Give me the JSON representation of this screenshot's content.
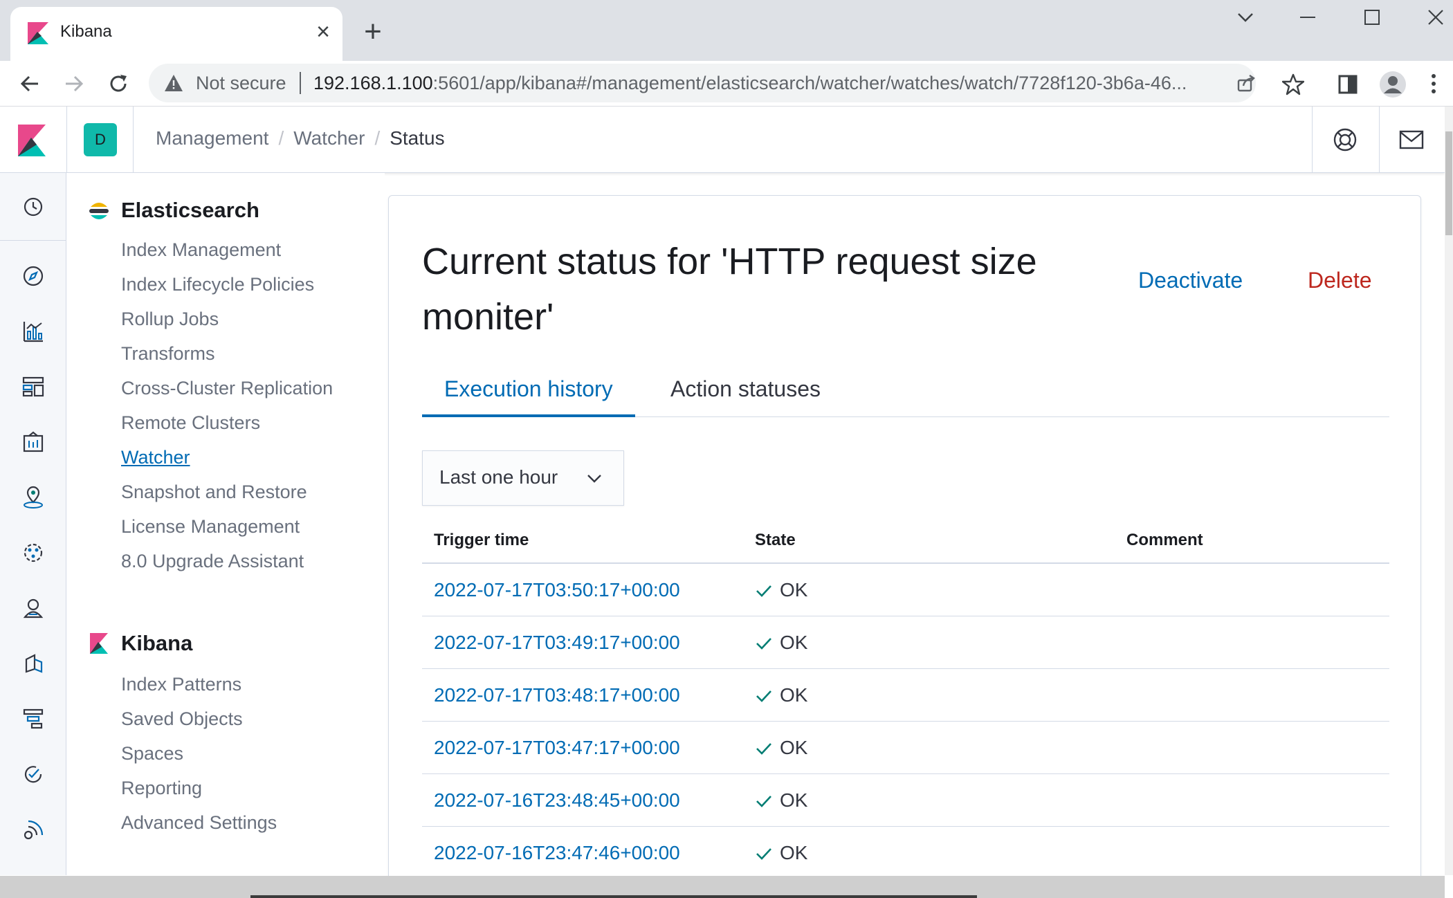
{
  "browser": {
    "tab_title": "Kibana",
    "url_warning": "Not secure",
    "url_host": "192.168.1.100",
    "url_rest": ":5601/app/kibana#/management/elasticsearch/watcher/watches/watch/7728f120-3b6a-46..."
  },
  "header": {
    "space_initial": "D",
    "breadcrumbs": [
      "Management",
      "Watcher",
      "Status"
    ],
    "separator": "/"
  },
  "sidenav": {
    "elasticsearch": {
      "title": "Elasticsearch",
      "items": [
        "Index Management",
        "Index Lifecycle Policies",
        "Rollup Jobs",
        "Transforms",
        "Cross-Cluster Replication",
        "Remote Clusters",
        "Watcher",
        "Snapshot and Restore",
        "License Management",
        "8.0 Upgrade Assistant"
      ],
      "active_item": "Watcher"
    },
    "kibana": {
      "title": "Kibana",
      "items": [
        "Index Patterns",
        "Saved Objects",
        "Spaces",
        "Reporting",
        "Advanced Settings"
      ]
    }
  },
  "main": {
    "title": "Current status for 'HTTP request size moniter'",
    "actions": {
      "deactivate": "Deactivate",
      "delete": "Delete"
    },
    "tabs": [
      {
        "label": "Execution history",
        "selected": true
      },
      {
        "label": "Action statuses",
        "selected": false
      }
    ],
    "time_range": "Last one hour",
    "table": {
      "columns": [
        "Trigger time",
        "State",
        "Comment"
      ],
      "rows": [
        {
          "trigger_time": "2022-07-17T03:50:17+00:00",
          "state": "OK",
          "comment": ""
        },
        {
          "trigger_time": "2022-07-17T03:49:17+00:00",
          "state": "OK",
          "comment": ""
        },
        {
          "trigger_time": "2022-07-17T03:48:17+00:00",
          "state": "OK",
          "comment": ""
        },
        {
          "trigger_time": "2022-07-17T03:47:17+00:00",
          "state": "OK",
          "comment": ""
        },
        {
          "trigger_time": "2022-07-16T23:48:45+00:00",
          "state": "OK",
          "comment": ""
        },
        {
          "trigger_time": "2022-07-16T23:47:46+00:00",
          "state": "OK",
          "comment": ""
        }
      ]
    }
  },
  "colors": {
    "link": "#006bb4",
    "danger": "#bd271e",
    "success": "#017d73",
    "space_avatar": "#10b9aa"
  },
  "icons": {
    "rail": [
      "clock-icon",
      "discover-icon",
      "visualize-icon",
      "dashboard-icon",
      "canvas-icon",
      "maps-icon",
      "ml-icon",
      "metrics-icon",
      "logs-icon",
      "apm-icon",
      "uptime-icon",
      "siem-icon"
    ],
    "header": [
      "help-icon",
      "newsfeed-icon"
    ]
  }
}
